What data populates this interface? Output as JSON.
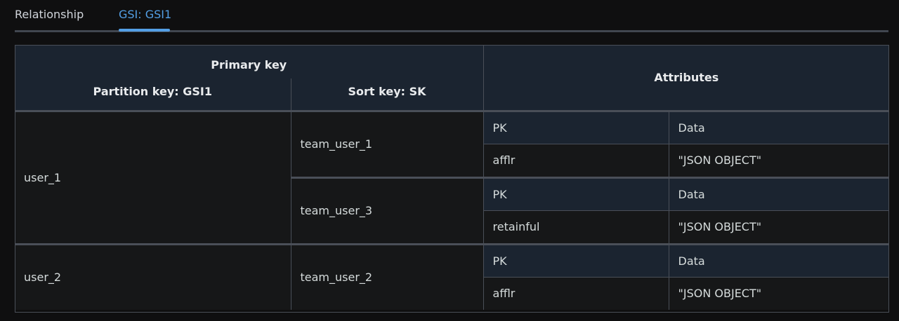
{
  "tabs": [
    {
      "label": "Relationship",
      "active": false
    },
    {
      "label": "GSI: GSI1",
      "active": true
    }
  ],
  "table": {
    "primary_key_label": "Primary key",
    "partition_key_label": "Partition key: GSI1",
    "sort_key_label": "Sort key: SK",
    "attributes_label": "Attributes",
    "groups": [
      {
        "partition": "user_1",
        "items": [
          {
            "sort": "team_user_1",
            "attr_headers": [
              "PK",
              "Data"
            ],
            "attr_values": [
              "afflr",
              "\"JSON OBJECT\""
            ]
          },
          {
            "sort": "team_user_3",
            "attr_headers": [
              "PK",
              "Data"
            ],
            "attr_values": [
              "retainful",
              "\"JSON OBJECT\""
            ]
          }
        ]
      },
      {
        "partition": "user_2",
        "items": [
          {
            "sort": "team_user_2",
            "attr_headers": [
              "PK",
              "Data"
            ],
            "attr_values": [
              "afflr",
              "\"JSON OBJECT\""
            ]
          }
        ]
      }
    ]
  },
  "colors": {
    "accent": "#539fe5",
    "header_bg": "#1b2430",
    "row_bg": "#161718",
    "page_bg": "#0f0f10"
  }
}
